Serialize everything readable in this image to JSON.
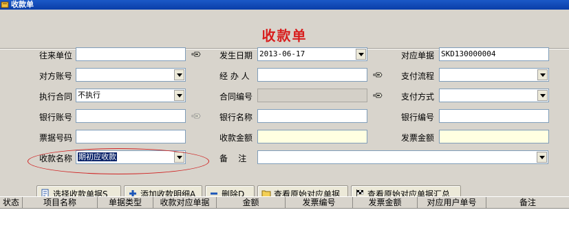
{
  "window": {
    "title": "收款单"
  },
  "form": {
    "title": "收款单",
    "labels": {
      "partner": "往来单位",
      "counter_account": "对方账号",
      "contract_exec": "执行合同",
      "bank_account": "银行账号",
      "note_no": "票据号码",
      "receipt_name": "收款名称",
      "date": "发生日期",
      "handler": "经 办 人",
      "contract_no": "合同编号",
      "bank_name": "银行名称",
      "receipt_amount": "收款金额",
      "remark": "备    注",
      "doc_no": "对应单据",
      "pay_flow": "支付流程",
      "pay_method": "支付方式",
      "bank_code": "银行编号",
      "invoice_amount": "发票金额"
    },
    "values": {
      "partner": "",
      "counter_account": "",
      "contract_exec": "不执行",
      "bank_account": "",
      "note_no": "",
      "receipt_name": "期初应收款",
      "date": "2013-06-17",
      "handler": "",
      "contract_no": "",
      "bank_name": "",
      "receipt_amount": "",
      "remark": "",
      "doc_no": "SKD130000004",
      "pay_flow": "",
      "pay_method": "",
      "bank_code": "",
      "invoice_amount": ""
    }
  },
  "toolbar": {
    "select_receipt": "选择收款单据S",
    "add_detail": "添加收款明细A",
    "delete": "删除D",
    "view_original": "查看原始对应单据",
    "view_original_summary": "查看原始对应单据汇总"
  },
  "grid": {
    "columns": [
      "状态",
      "项目名称",
      "单据类型",
      "收款对应单据",
      "金额",
      "发票编号",
      "发票金额",
      "对应用户单号",
      "备注"
    ]
  },
  "colors": {
    "title_red": "#d81e1e",
    "panel": "#d8d4cc",
    "highlight_oval": "#d02020",
    "amount_yellow": "#ffffe1"
  }
}
